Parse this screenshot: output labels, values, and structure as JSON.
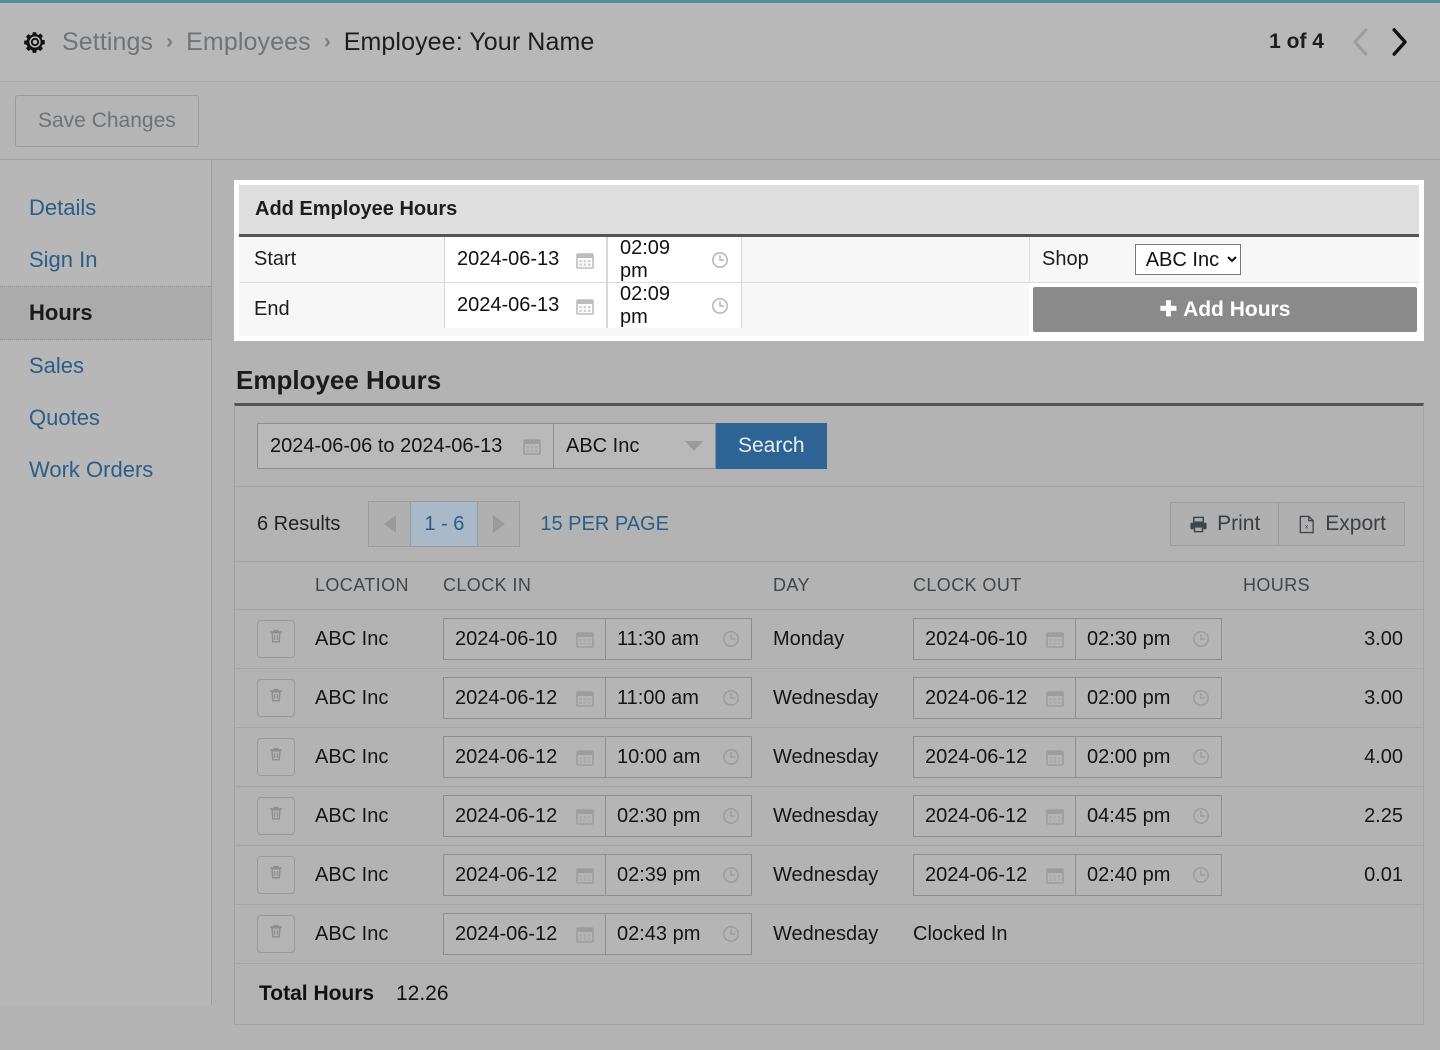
{
  "header": {
    "gear_icon": "gear-icon",
    "breadcrumb": [
      {
        "label": "Settings",
        "current": false
      },
      {
        "label": "Employees",
        "current": false
      },
      {
        "label": "Employee: Your Name",
        "current": true
      }
    ],
    "separator": "›",
    "page_count": "1 of 4",
    "prev_icon": "chevron-left-icon",
    "next_icon": "chevron-right-icon"
  },
  "toolbar": {
    "save_label": "Save Changes"
  },
  "sidebar": {
    "items": [
      {
        "label": "Details",
        "active": false
      },
      {
        "label": "Sign In",
        "active": false
      },
      {
        "label": "Hours",
        "active": true
      },
      {
        "label": "Sales",
        "active": false
      },
      {
        "label": "Quotes",
        "active": false
      },
      {
        "label": "Work Orders",
        "active": false
      }
    ]
  },
  "add_hours": {
    "title": "Add Employee Hours",
    "start_label": "Start",
    "start_date": "2024-06-13",
    "start_time": "02:09 pm",
    "end_label": "End",
    "end_date": "2024-06-13",
    "end_time": "02:09 pm",
    "shop_label": "Shop",
    "shop_value": "ABC Inc",
    "shop_options": [
      "ABC Inc"
    ],
    "add_button": "Add Hours",
    "add_button_icon": "plus-icon"
  },
  "employee_hours": {
    "title": "Employee Hours",
    "date_range": "2024-06-06 to 2024-06-13",
    "shop_filter": "ABC Inc",
    "search_label": "Search",
    "results_count": "6 Results",
    "page_label": "1 - 6",
    "per_page_label": "15 PER PAGE",
    "print_label": "Print",
    "export_label": "Export",
    "columns": [
      "",
      "LOCATION",
      "CLOCK IN",
      "DAY",
      "CLOCK OUT",
      "HOURS"
    ],
    "rows": [
      {
        "location": "ABC Inc",
        "in_date": "2024-06-10",
        "in_time": "11:30 am",
        "day": "Monday",
        "out_date": "2024-06-10",
        "out_time": "02:30 pm",
        "hours": "3.00",
        "clocked_in": false
      },
      {
        "location": "ABC Inc",
        "in_date": "2024-06-12",
        "in_time": "11:00 am",
        "day": "Wednesday",
        "out_date": "2024-06-12",
        "out_time": "02:00 pm",
        "hours": "3.00",
        "clocked_in": false
      },
      {
        "location": "ABC Inc",
        "in_date": "2024-06-12",
        "in_time": "10:00 am",
        "day": "Wednesday",
        "out_date": "2024-06-12",
        "out_time": "02:00 pm",
        "hours": "4.00",
        "clocked_in": false
      },
      {
        "location": "ABC Inc",
        "in_date": "2024-06-12",
        "in_time": "02:30 pm",
        "day": "Wednesday",
        "out_date": "2024-06-12",
        "out_time": "04:45 pm",
        "hours": "2.25",
        "clocked_in": false
      },
      {
        "location": "ABC Inc",
        "in_date": "2024-06-12",
        "in_time": "02:39 pm",
        "day": "Wednesday",
        "out_date": "2024-06-12",
        "out_time": "02:40 pm",
        "hours": "0.01",
        "clocked_in": false
      },
      {
        "location": "ABC Inc",
        "in_date": "2024-06-12",
        "in_time": "02:43 pm",
        "day": "Wednesday",
        "out_date": "",
        "out_time": "",
        "hours": "",
        "clocked_in": true,
        "clocked_in_label": "Clocked In"
      }
    ],
    "total_label": "Total Hours",
    "total_value": "12.26"
  },
  "colors": {
    "accent_teal": "#4d8f96",
    "link_blue": "#2a5d89",
    "search_blue": "#2e6396",
    "page_bg": "#b3b3b3",
    "card_white": "#ffffff",
    "add_button_grey": "#8a8a8a"
  }
}
